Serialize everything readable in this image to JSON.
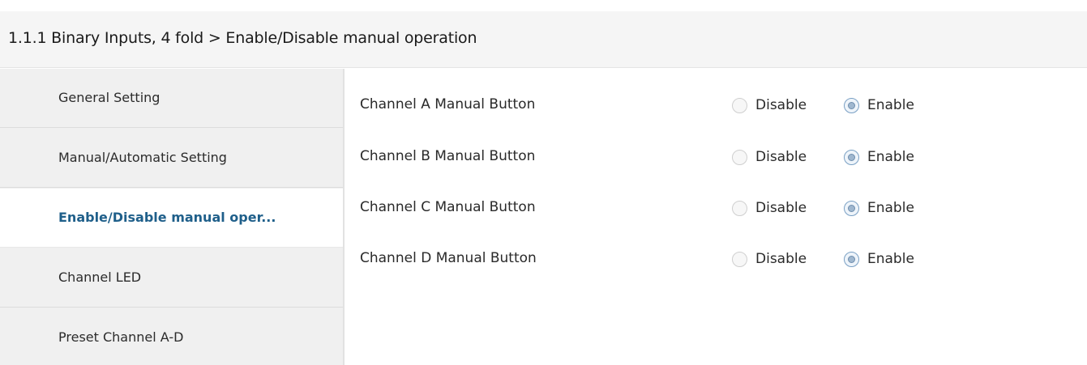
{
  "header": {
    "title": "1.1.1 Binary Inputs, 4 fold > Enable/Disable manual operation"
  },
  "sidebar": {
    "items": [
      {
        "label": "General Setting",
        "active": false
      },
      {
        "label": "Manual/Automatic Setting",
        "active": false
      },
      {
        "label": "Enable/Disable manual oper...",
        "active": true
      },
      {
        "label": "Channel LED",
        "active": false
      },
      {
        "label": "Preset Channel A-D",
        "active": false
      }
    ]
  },
  "parameters": [
    {
      "label": "Channel A Manual Button",
      "options": [
        "Disable",
        "Enable"
      ],
      "selected": "Enable"
    },
    {
      "label": "Channel B Manual Button",
      "options": [
        "Disable",
        "Enable"
      ],
      "selected": "Enable"
    },
    {
      "label": "Channel C Manual Button",
      "options": [
        "Disable",
        "Enable"
      ],
      "selected": "Enable"
    },
    {
      "label": "Channel D Manual Button",
      "options": [
        "Disable",
        "Enable"
      ],
      "selected": "Enable"
    }
  ],
  "colors": {
    "active_nav_text": "#1f5f8a",
    "sidebar_bg": "#f0f0f0",
    "header_bg": "#f5f5f5",
    "radio_checked": "#7aa0c4"
  }
}
